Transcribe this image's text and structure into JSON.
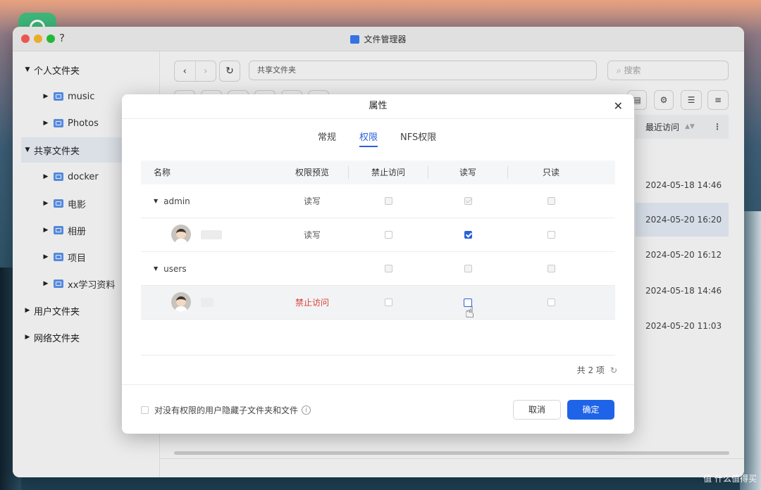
{
  "window": {
    "title": "文件管理器",
    "help": "?"
  },
  "sidebar": {
    "sections": [
      {
        "label": "个人文件夹",
        "children": [
          "music",
          "Photos"
        ]
      },
      {
        "label": "共享文件夹",
        "children": [
          "docker",
          "电影",
          "相册",
          "项目",
          "xx学习资料"
        ]
      },
      {
        "label": "用户文件夹"
      },
      {
        "label": "网络文件夹"
      }
    ]
  },
  "toolbar": {
    "path": "共享文件夹",
    "search_placeholder": "搜索"
  },
  "list": {
    "column_header": "最近访问",
    "dates": [
      "2024-05-18 14:46",
      "2024-05-20 16:20",
      "2024-05-20 16:12",
      "2024-05-18 14:46",
      "2024-05-20 11:03"
    ]
  },
  "dialog": {
    "title": "属性",
    "tabs": [
      "常规",
      "权限",
      "NFS权限"
    ],
    "active_tab": "权限",
    "columns": [
      "名称",
      "权限预览",
      "禁止访问",
      "读写",
      "只读"
    ],
    "rows": [
      {
        "type": "group",
        "name": "admin",
        "preview": "读写",
        "deny": false,
        "rw": true,
        "ro": false
      },
      {
        "type": "user",
        "name": "",
        "preview": "读写",
        "deny": false,
        "rw": true,
        "ro": false
      },
      {
        "type": "group",
        "name": "users",
        "preview": "",
        "deny": false,
        "rw": false,
        "ro": false
      },
      {
        "type": "user",
        "name": "",
        "preview": "禁止访问",
        "deny": false,
        "rw": false,
        "ro": false
      }
    ],
    "count_label": "共 2 项",
    "hide_option": "对没有权限的用户隐藏子文件夹和文件",
    "cancel": "取消",
    "ok": "确定"
  },
  "colors": {
    "accent": "#1f64e8",
    "deny": "#d9403a"
  },
  "watermark": "值 什么值得买"
}
